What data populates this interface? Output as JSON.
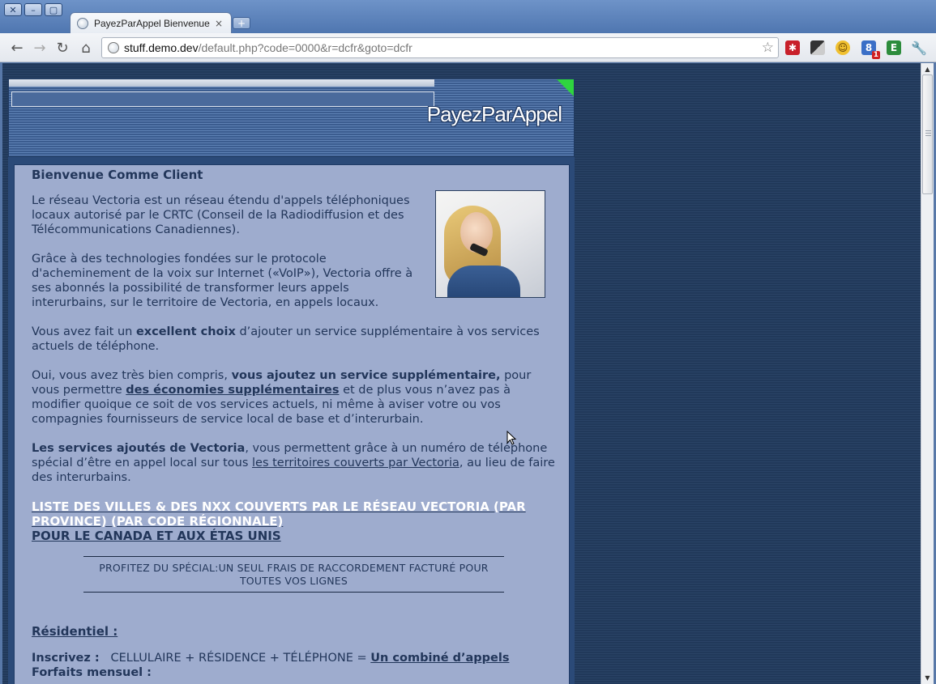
{
  "browser": {
    "window_buttons": [
      "✕",
      "–",
      "▢"
    ],
    "tab_title": "PayezParAppel Bienvenue",
    "tab_close": "×",
    "new_tab": "+",
    "url_host": "stuff.demo.dev",
    "url_path": "/default.php?code=0000&r=dcfr&goto=dcfr",
    "nav": {
      "back": "←",
      "forward": "→",
      "reload": "↻",
      "home": "⌂"
    },
    "star": "☆",
    "extensions": [
      "red-asterisk-icon",
      "chequered-icon",
      "smiley-icon",
      "notification-badge-icon",
      "evernote-icon",
      "wrench-icon"
    ],
    "badge_count": "1"
  },
  "banner": {
    "logo": "PayezParAppel"
  },
  "content": {
    "title": "Bienvenue Comme Client",
    "p1": "Le réseau Vectoria est un réseau étendu d'appels téléphoniques locaux autorisé par le CRTC (Conseil de la Radiodiffusion et des Télécommunications Canadiennes).",
    "p2": "Grâce à des technologies fondées sur le protocole d'acheminement de la voix sur Internet («VoIP»), Vectoria offre à ses abonnés la possibilité de transformer leurs appels interurbains, sur le territoire de Vectoria, en appels locaux.",
    "p3_a": "Vous avez fait un ",
    "p3_b": "excellent choix",
    "p3_c": " d’ajouter un service supplémentaire à vos services actuels de téléphone.",
    "p4_a": "Oui, vous avez très bien compris, ",
    "p4_b": "vous ajoutez un service supplémentaire,",
    "p4_c": " pour vous permettre ",
    "p4_link": "des économies supplémentaires",
    "p4_d": " et de plus vous n’avez pas à modifier quoique ce soit de vos services actuels, ni même à aviser votre ou vos compagnies fournisseurs de service local de base et d’interurbain.",
    "p5_a": "Les services ajoutés de Vectoria",
    "p5_b": ", vous permettent grâce à un numéro de téléphone spécial d’être en appel local sur tous ",
    "p5_link": "les territoires couverts par Vectoria",
    "p5_c": ", au lieu de faire des interurbains.",
    "link_list": "LISTE DES VILLES & DES NXX COUVERTS PAR LE RÉSEAU VECTORIA (PAR PROVINCE) (PAR CODE RÉGIONNALE)",
    "link_canada": "POUR LE CANADA ET AUX ÉTAS UNIS",
    "special": "PROFITEZ DU SPÉCIAL:UN SEUL FRAIS DE RACCORDEMENT FACTURÉ POUR TOUTES VOS LIGNES",
    "residentiel": "Résidentiel :",
    "inscr_label": "Inscrivez :",
    "inscr_text": "   CELLULAIRE + RÉSIDENCE + TÉLÉPHONE = ",
    "inscr_link": "Un combiné d’appels",
    "forfaits": "Forfaits mensuel :"
  }
}
